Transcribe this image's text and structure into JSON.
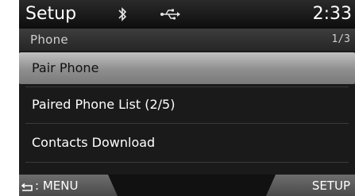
{
  "header": {
    "title": "Setup",
    "bluetooth_icon": "bluetooth-icon",
    "usb_icon": "usb-icon",
    "time": "2:33"
  },
  "subheader": {
    "title": "Phone",
    "page": "1/3"
  },
  "menu": {
    "items": [
      {
        "label": "Pair Phone",
        "selected": true
      },
      {
        "label": "Paired Phone List (2/5)",
        "selected": false
      },
      {
        "label": "Contacts Download",
        "selected": false
      }
    ]
  },
  "footer": {
    "menu_label": ": MENU",
    "menu_icon": "return-icon",
    "setup_label": "SETUP"
  },
  "colors": {
    "background": "#1a1a1a",
    "selected_item": "#9a9a9a",
    "text": "#ffffff"
  }
}
